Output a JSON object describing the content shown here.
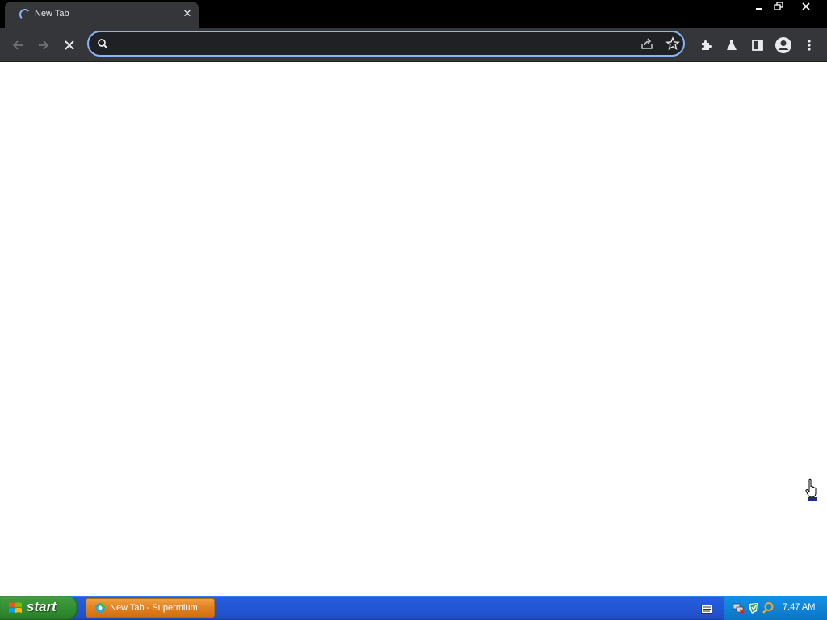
{
  "browser": {
    "tab": {
      "title": "New Tab",
      "close_glyph": "✕"
    },
    "window_controls": [
      "minimize-icon",
      "restore-icon",
      "close-icon"
    ],
    "toolbar": {
      "back_icon": "arrow-left-icon",
      "forward_icon": "arrow-right-icon",
      "stop_icon": "stop-loading-icon",
      "omnibox": {
        "value": "",
        "placeholder": ""
      },
      "right_icons": [
        "share-icon",
        "bookmark-star-icon",
        "extensions-icon",
        "labs-flask-icon",
        "side-panel-icon",
        "profile-avatar-icon",
        "menu-kebab-icon"
      ]
    },
    "colors": {
      "tabstrip": "#000000",
      "toolbar": "#35363a",
      "omnibox_bg": "#202124",
      "focus_ring": "#8ab4f8",
      "page_bg": "#ffffff"
    }
  },
  "taskbar": {
    "start_label": "start",
    "task_label": "New Tab - Supermium",
    "clock": "7:47 AM",
    "colors": {
      "bar": "#245edb",
      "start": "#3c9a3c",
      "active_task": "#e08020",
      "tray": "#0f84d8"
    }
  }
}
